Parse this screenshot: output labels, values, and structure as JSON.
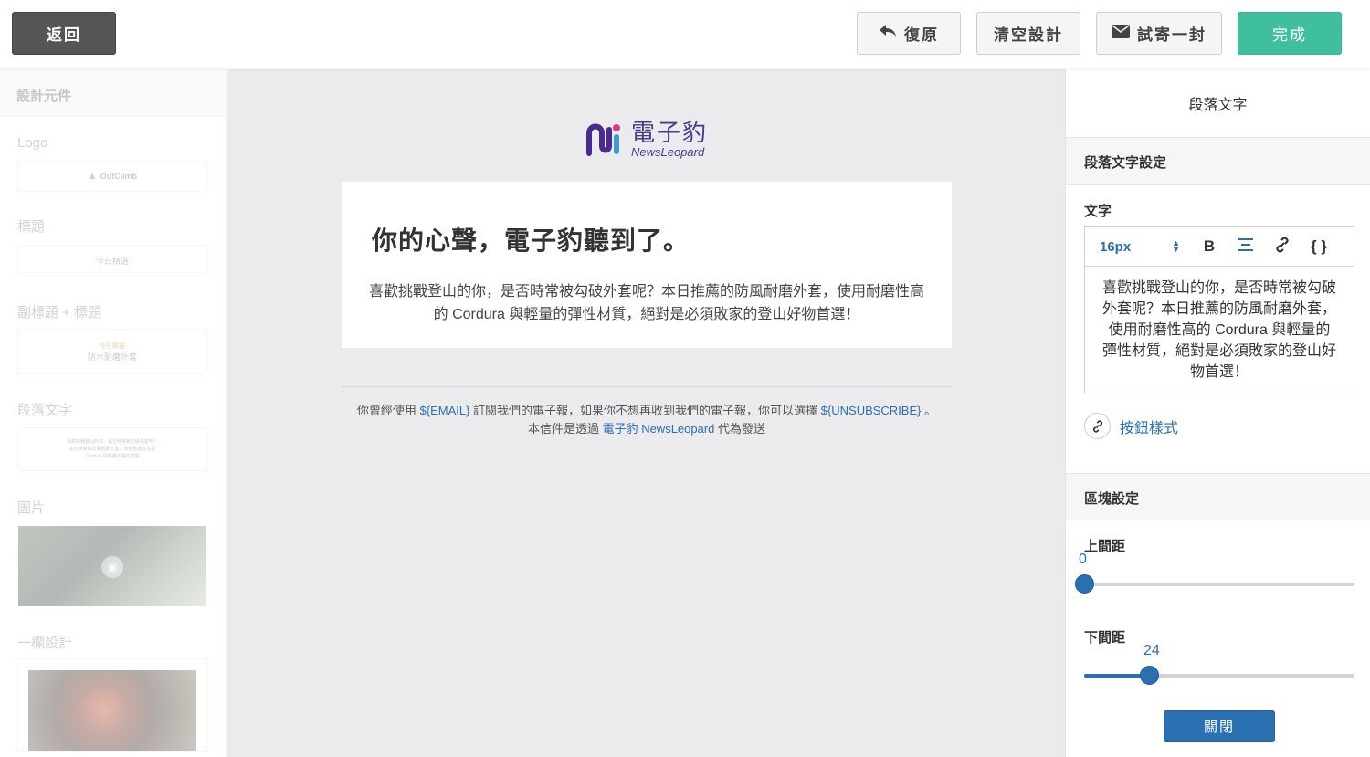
{
  "topbar": {
    "back_label": "返回",
    "undo_label": "復原",
    "clear_label": "清空設計",
    "test_label": "試寄一封",
    "done_label": "完成"
  },
  "sidebar": {
    "header": "設計元件",
    "components": [
      {
        "label": "Logo",
        "preview": "OutClimb"
      },
      {
        "label": "標題",
        "preview": "今日精選"
      },
      {
        "label": "副標題 + 標題",
        "preview_sub": "今日精選",
        "preview": "防水耐磨外套"
      },
      {
        "label": "段落文字",
        "preview_lines": [
          "喜歡挑戰登山的你，是否時常被勾破外套呢？",
          "本日推薦的防風耐磨外套，使用耐磨性高的",
          "Cordura 與輕量的彈性材質"
        ]
      },
      {
        "label": "圖片"
      },
      {
        "label": "一欄設計"
      }
    ]
  },
  "canvas": {
    "logo_cn": "電子豹",
    "logo_en": "NewsLeopard",
    "title": "你的心聲，電子豹聽到了。",
    "body": "喜歡挑戰登山的你，是否時常被勾破外套呢？本日推薦的防風耐磨外套，使用耐磨性高的 Cordura 與輕量的彈性材質，絕對是必須敗家的登山好物首選！",
    "footer": {
      "line1_a": "你曾經使用 ",
      "email_var": "${EMAIL}",
      "line1_b": " 訂閱我們的電子報，如果你不想再收到我們的電子報，你可以選擇 ",
      "unsub_var": "${UNSUBSCRIBE}",
      "line1_c": " 。",
      "line2_a": "本信件是透過 ",
      "brand_link": "電子豹 NewsLeopard",
      "line2_b": " 代為發送"
    }
  },
  "panel": {
    "title": "段落文字",
    "section1": "段落文字設定",
    "text_label": "文字",
    "font_size": "16px",
    "bold_label": "B",
    "code_label": "{ }",
    "editor_text": "喜歡挑戰登山的你，是否時常被勾破外套呢？本日推薦的防風耐磨外套，使用耐磨性高的 Cordura 與輕量的彈性材質，絕對是必須敗家的登山好物首選！",
    "button_style_label": "按鈕樣式",
    "section2": "區塊設定",
    "top_padding_label": "上間距",
    "top_padding_value": "0",
    "bottom_padding_label": "下間距",
    "bottom_padding_value": "24",
    "top_padding_fraction": 0.0,
    "bottom_padding_fraction": 0.24,
    "close_label": "關閉"
  },
  "colors": {
    "accent": "#2a6fb0",
    "done_green": "#3fbf9c",
    "brand_purple": "#4a3a8c"
  }
}
